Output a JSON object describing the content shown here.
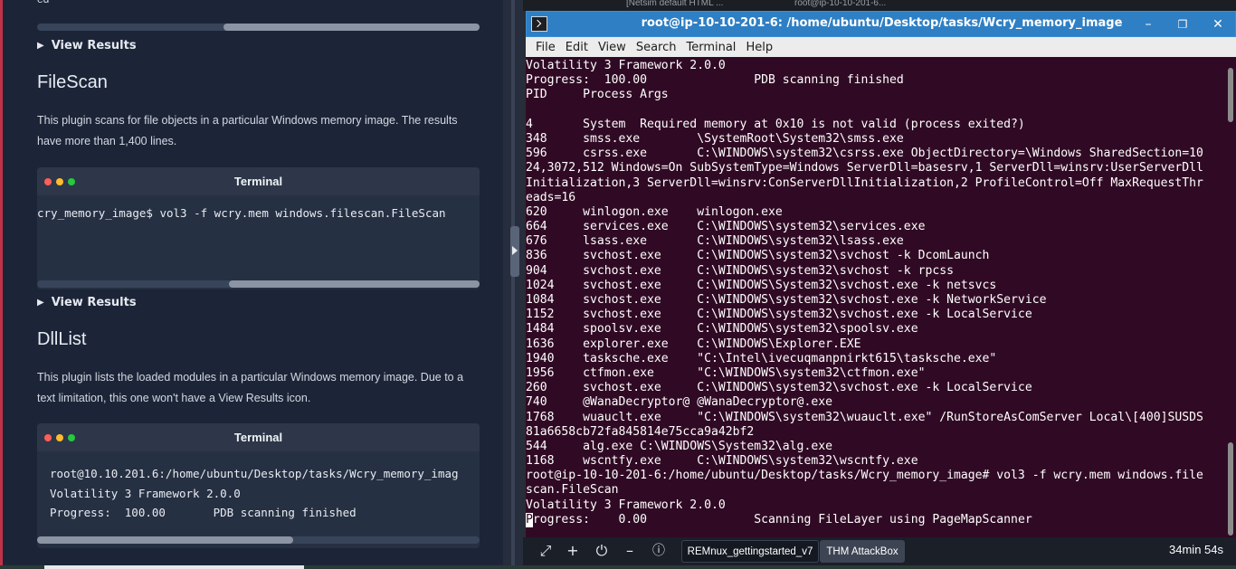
{
  "left": {
    "prev_text": "ed",
    "view_results_1": "View Results",
    "filescan": {
      "heading": "FileScan",
      "description": "This plugin scans for file objects in a particular Windows memory image. The results have more than 1,400 lines.",
      "terminal_title": "Terminal",
      "command": "cry_memory_image$ vol3 -f wcry.mem windows.filescan.FileScan",
      "view_results": "View Results"
    },
    "dlllist": {
      "heading": "DllList",
      "description": "This plugin lists the loaded modules in a particular Windows memory image. Due to a text limitation, this one won't have a View Results icon.",
      "terminal_title": "Terminal",
      "lines": [
        "root@10.10.201.6:/home/ubuntu/Desktop/tasks/Wcry_memory_imag",
        "Volatility 3 Framework 2.0.0",
        "Progress:  100.00       PDB scanning finished"
      ]
    },
    "colors": {
      "dot_red": "#ff5f57",
      "dot_yellow": "#febc2e",
      "dot_green": "#28c840",
      "accent": "#c1324a"
    }
  },
  "vm": {
    "top_tabs": [
      "[Netsim default HTML ...",
      "root@ip-10-10-201-6..."
    ],
    "window_title": "root@ip-10-10-201-6: /home/ubuntu/Desktop/tasks/Wcry_memory_image",
    "menu": [
      "File",
      "Edit",
      "View",
      "Search",
      "Terminal",
      "Help"
    ],
    "terminal_lines": [
      "Volatility 3 Framework 2.0.0",
      "Progress:  100.00               PDB scanning finished",
      "PID     Process Args",
      "",
      "4       System  Required memory at 0x10 is not valid (process exited?)",
      "348     smss.exe        \\SystemRoot\\System32\\smss.exe",
      "596     csrss.exe       C:\\WINDOWS\\system32\\csrss.exe ObjectDirectory=\\Windows SharedSection=10",
      "24,3072,512 Windows=On SubSystemType=Windows ServerDll=basesrv,1 ServerDll=winsrv:UserServerDll",
      "Initialization,3 ServerDll=winsrv:ConServerDllInitialization,2 ProfileControl=Off MaxRequestThr",
      "eads=16",
      "620     winlogon.exe    winlogon.exe",
      "664     services.exe    C:\\WINDOWS\\system32\\services.exe",
      "676     lsass.exe       C:\\WINDOWS\\system32\\lsass.exe",
      "836     svchost.exe     C:\\WINDOWS\\system32\\svchost -k DcomLaunch",
      "904     svchost.exe     C:\\WINDOWS\\system32\\svchost -k rpcss",
      "1024    svchost.exe     C:\\WINDOWS\\System32\\svchost.exe -k netsvcs",
      "1084    svchost.exe     C:\\WINDOWS\\system32\\svchost.exe -k NetworkService",
      "1152    svchost.exe     C:\\WINDOWS\\system32\\svchost.exe -k LocalService",
      "1484    spoolsv.exe     C:\\WINDOWS\\system32\\spoolsv.exe",
      "1636    explorer.exe    C:\\WINDOWS\\Explorer.EXE",
      "1940    tasksche.exe    \"C:\\Intel\\ivecuqmanpnirkt615\\tasksche.exe\"",
      "1956    ctfmon.exe      \"C:\\WINDOWS\\system32\\ctfmon.exe\"",
      "260     svchost.exe     C:\\WINDOWS\\system32\\svchost.exe -k LocalService",
      "740     @WanaDecryptor@ @WanaDecryptor@.exe",
      "1768    wuauclt.exe     \"C:\\WINDOWS\\system32\\wuauclt.exe\" /RunStoreAsComServer Local\\[400]SUSDS",
      "81a6658cb72fa845814e75cca9a42bf2",
      "544     alg.exe C:\\WINDOWS\\System32\\alg.exe",
      "1168    wscntfy.exe     C:\\WINDOWS\\system32\\wscntfy.exe",
      "root@ip-10-10-201-6:/home/ubuntu/Desktop/tasks/Wcry_memory_image# vol3 -f wcry.mem windows.file",
      "scan.FileScan",
      "Volatility 3 Framework 2.0.0"
    ],
    "last_line_cursor_char": "P",
    "last_line_rest": "rogress:    0.00               Scanning FileLayer using PageMapScanner",
    "toolbar": {
      "tab1": "REMnux_gettingstarted_v7",
      "tab2": "THM AttackBox",
      "timer": "34min 54s"
    }
  }
}
